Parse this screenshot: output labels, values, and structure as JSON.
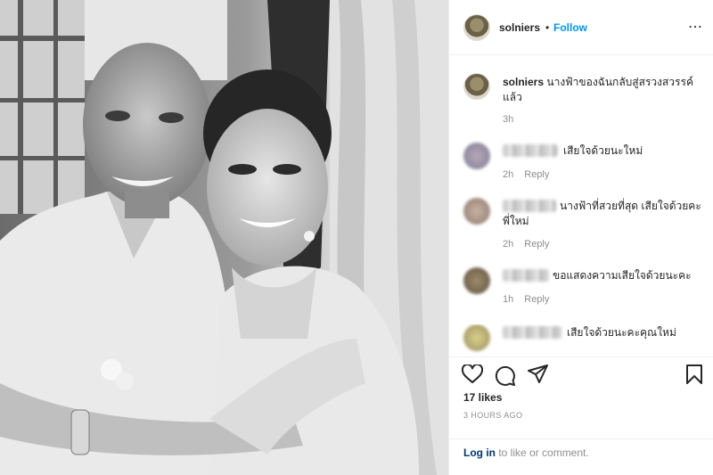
{
  "post": {
    "photo_desc_icon": "photo-image"
  },
  "header": {
    "username": "solniers",
    "dot": "•",
    "follow_label": "Follow",
    "more_icon": "⋯"
  },
  "caption": {
    "username": "solniers",
    "text": "นางฟ้าของฉันกลับสู่สรวงสวรรค์แล้ว",
    "time": "3h"
  },
  "comments": [
    {
      "text": "เสียใจด้วยนะใหม่",
      "time": "2h",
      "reply": "Reply"
    },
    {
      "text": "นางฟ้าที่สวยที่สุด เสียใจด้วยคะ พี่ใหม่",
      "time": "2h",
      "reply": "Reply"
    },
    {
      "text": "ขอแสดงความเสียใจด้วยนะคะ",
      "time": "1h",
      "reply": "Reply"
    },
    {
      "text": "เสียใจด้วยนะคะคุณใหม่",
      "time": "",
      "reply": ""
    }
  ],
  "actions": {
    "like_icon": "heart-icon",
    "comment_icon": "comment-icon",
    "share_icon": "share-icon",
    "save_icon": "bookmark-icon",
    "likes": "17 likes",
    "ago": "3 HOURS AGO"
  },
  "login": {
    "link": "Log in",
    "rest": " to like or comment."
  },
  "colors": {
    "link_blue": "#0095f6",
    "text": "#262626",
    "muted": "#8e8e8e"
  }
}
